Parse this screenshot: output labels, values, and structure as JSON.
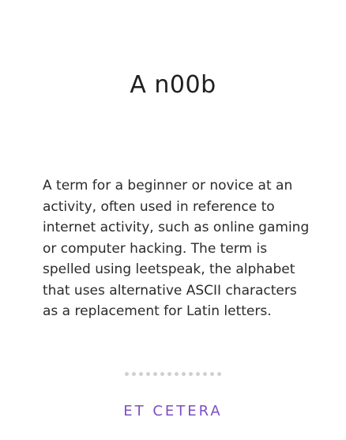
{
  "card": {
    "title": "A n00b",
    "definition": "A term for a beginner or novice at an activity, often used in reference to internet activity, such as online gaming or computer hacking. The term is spelled using leetspeak, the alphabet that uses alternative ASCII characters as a replacement for Latin letters.",
    "brand": "ET CETERA"
  },
  "colors": {
    "accent": "#7b4fc4",
    "dots": "#d0d0d0",
    "text": "#2b2b2b"
  }
}
